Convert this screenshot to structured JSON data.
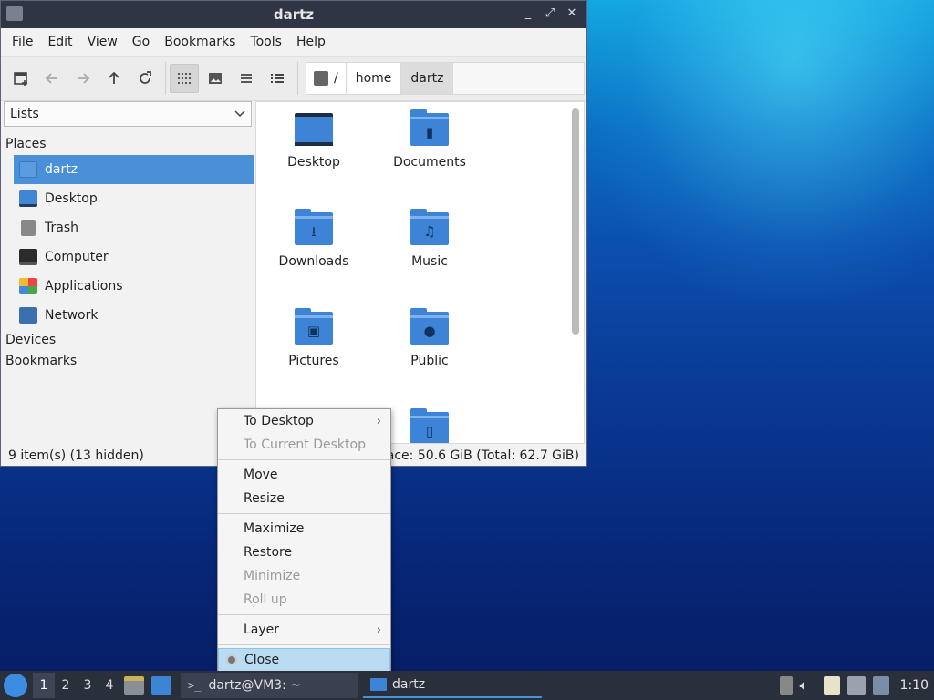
{
  "window": {
    "title": "dartz",
    "controls": [
      "_",
      "⤢",
      "✕"
    ]
  },
  "menubar": [
    "File",
    "Edit",
    "View",
    "Go",
    "Bookmarks",
    "Tools",
    "Help"
  ],
  "pathbar": {
    "root": "/",
    "crumbs": [
      "home",
      "dartz"
    ]
  },
  "sidebar": {
    "combo_value": "Lists",
    "places_header": "Places",
    "places": [
      "dartz",
      "Desktop",
      "Trash",
      "Computer",
      "Applications",
      "Network"
    ],
    "devices_header": "Devices",
    "bookmarks_header": "Bookmarks"
  },
  "files": [
    "Desktop",
    "Documents",
    "Downloads",
    "Music",
    "Pictures",
    "Public"
  ],
  "status": {
    "left": "9 item(s) (13 hidden)",
    "right": "Free space: 50.6 GiB (Total: 62.7 GiB)"
  },
  "context_menu": {
    "to_desktop": "To Desktop",
    "to_current_desktop": "To Current Desktop",
    "move": "Move",
    "resize": "Resize",
    "maximize": "Maximize",
    "restore": "Restore",
    "minimize": "Minimize",
    "roll_up": "Roll up",
    "layer": "Layer",
    "close": "Close"
  },
  "taskbar": {
    "workspaces": [
      "1",
      "2",
      "3",
      "4"
    ],
    "task_terminal": "dartz@VM3: ~",
    "task_terminal_icon": ">_",
    "task_filemanager": "dartz",
    "clock": "1:10"
  }
}
